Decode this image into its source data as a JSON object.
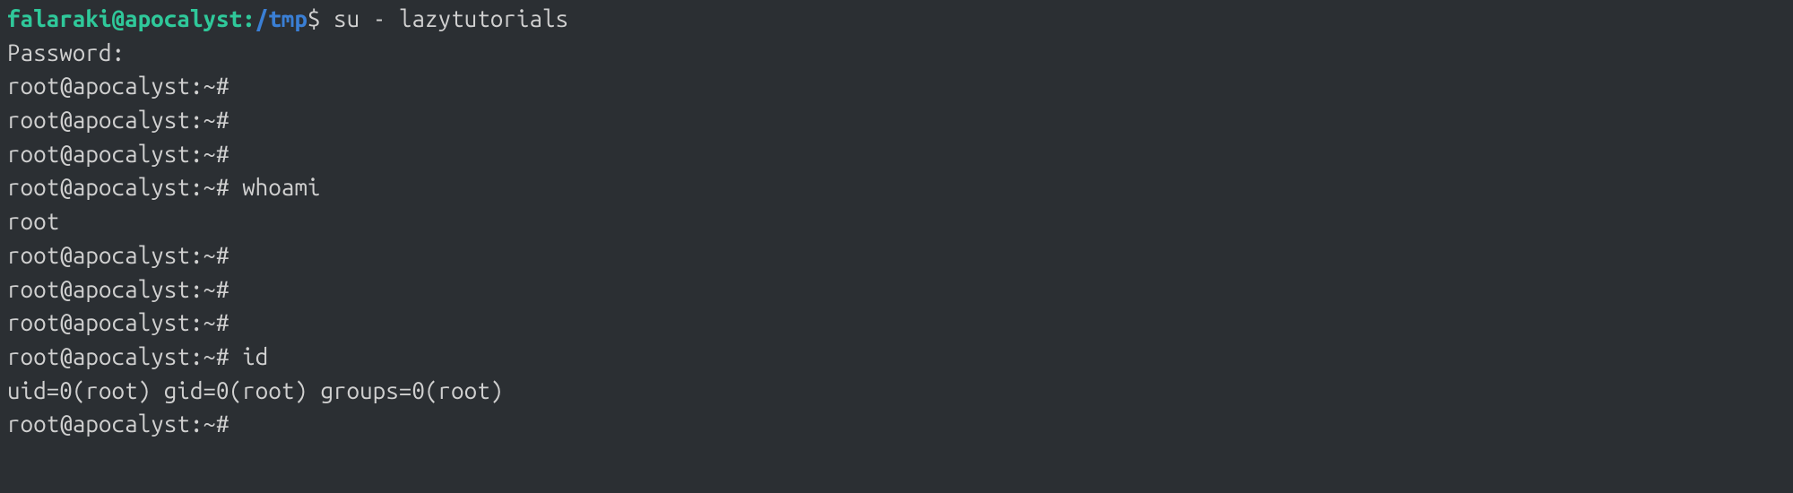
{
  "prompt1": {
    "userhost": "falaraki@apocalyst",
    "colon": ":",
    "path": "/tmp",
    "symbol": "$ ",
    "command": "su - lazytutorials"
  },
  "password_label": "Password:",
  "root_prompt": "root@apocalyst:~#",
  "lines": {
    "empty1": "root@apocalyst:~#",
    "empty2": "root@apocalyst:~#",
    "empty3": "root@apocalyst:~#",
    "whoami_prompt": "root@apocalyst:~# ",
    "whoami_cmd": "whoami",
    "whoami_out": "root",
    "empty4": "root@apocalyst:~#",
    "empty5": "root@apocalyst:~#",
    "empty6": "root@apocalyst:~#",
    "id_prompt": "root@apocalyst:~# ",
    "id_cmd": "id",
    "id_out": "uid=0(root) gid=0(root) groups=0(root)",
    "final": "root@apocalyst:~#"
  }
}
